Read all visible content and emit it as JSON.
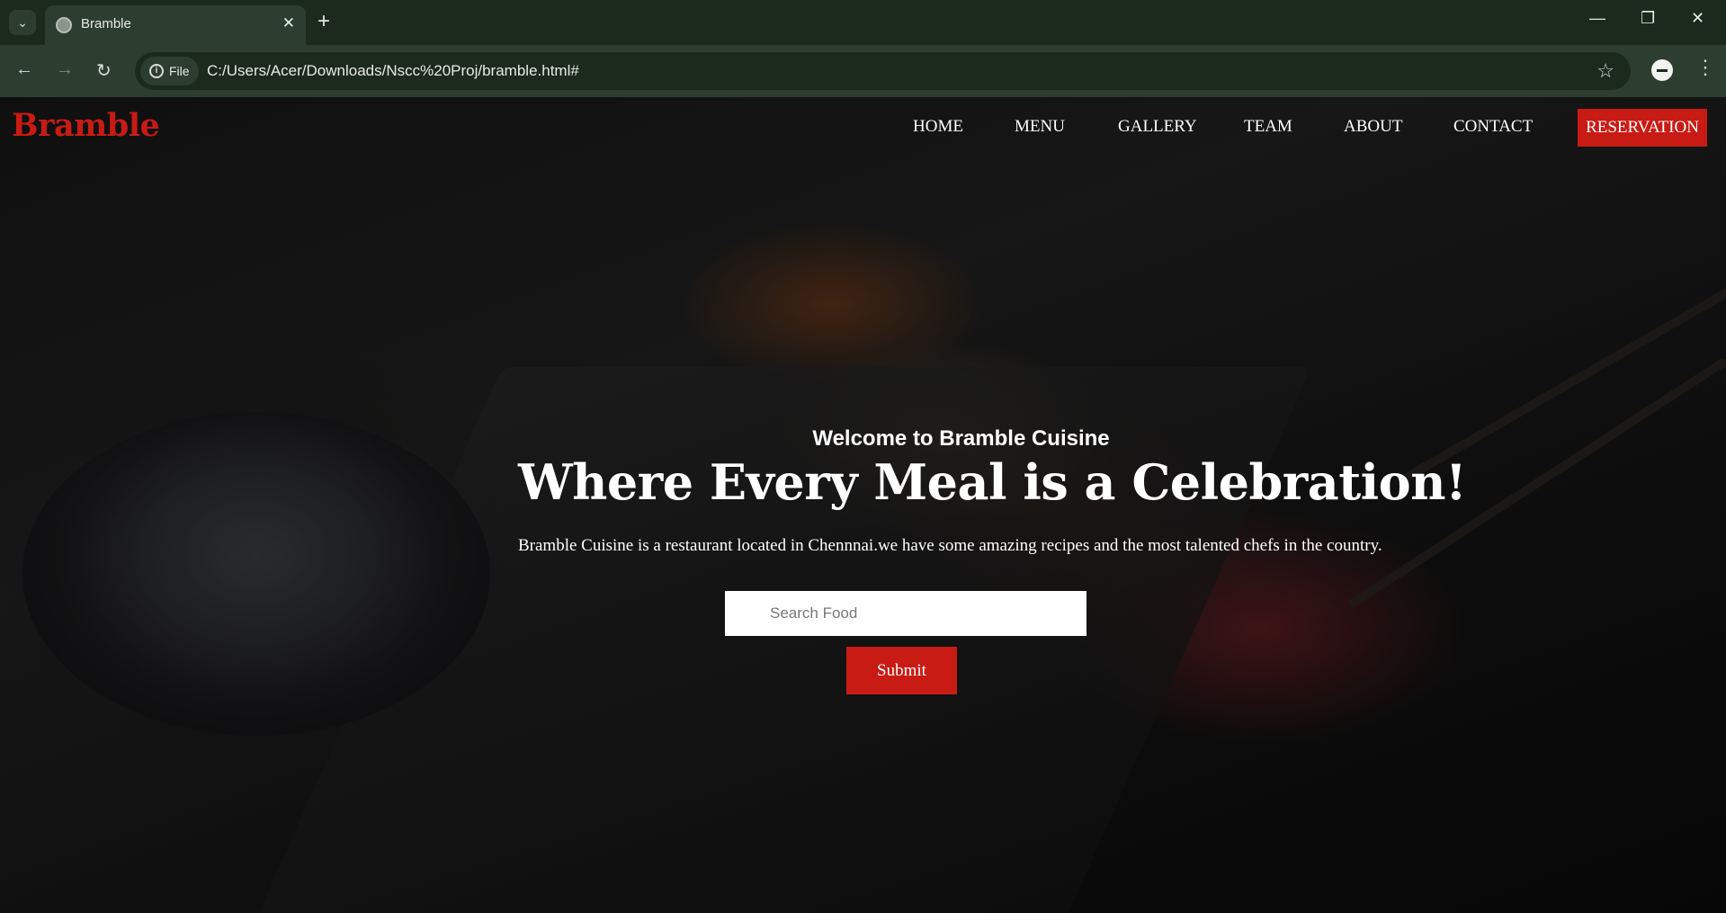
{
  "browser": {
    "tab_title": "Bramble",
    "url": "C:/Users/Acer/Downloads/Nscc%20Proj/bramble.html#",
    "file_chip_label": "File",
    "icons": {
      "tab_menu": "chevron-down-icon",
      "tab_favicon": "globe-icon",
      "tab_close": "close-icon",
      "new_tab": "plus-icon",
      "back": "arrow-left-icon",
      "forward": "arrow-right-icon",
      "reload": "reload-icon",
      "bookmark": "star-icon",
      "menu": "kebab-icon"
    }
  },
  "site": {
    "logo": "Bramble",
    "nav": [
      {
        "label": "HOME"
      },
      {
        "label": "MENU"
      },
      {
        "label": "GALLERY"
      },
      {
        "label": "TEAM"
      },
      {
        "label": "ABOUT"
      },
      {
        "label": "CONTACT"
      }
    ],
    "reservation_label": "RESERVATION",
    "accent_color": "#c81b14"
  },
  "hero": {
    "eyebrow": "Welcome to Bramble Cuisine",
    "title": "Where Every Meal is a Celebration!",
    "description": "Bramble Cuisine is a restaurant located in Chennnai.we have some amazing recipes and the most talented chefs in the country.",
    "search_placeholder": "Search Food",
    "submit_label": "Submit"
  }
}
